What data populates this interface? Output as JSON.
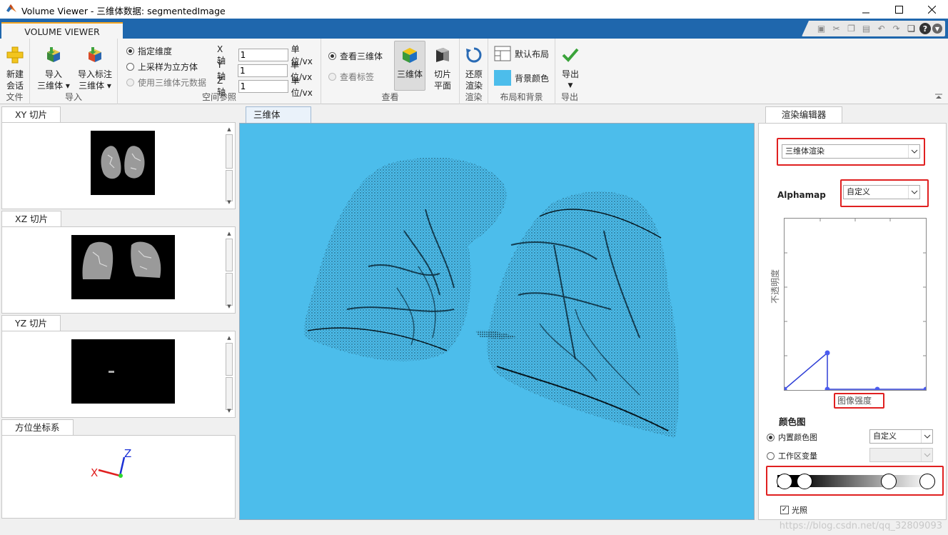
{
  "window": {
    "title": "Volume Viewer - 三维体数据: segmentedImage"
  },
  "ribbon_tab": {
    "label": "VOLUME VIEWER"
  },
  "ribbon": {
    "file": {
      "new_session": [
        "新建",
        "会话"
      ],
      "label": "文件"
    },
    "import": {
      "import_volume": [
        "导入",
        "三维体 ▾"
      ],
      "import_labeled": [
        "导入标注",
        "三维体 ▾"
      ],
      "label": "导入"
    },
    "spatial": {
      "opt_specify": "指定维度",
      "opt_upsample": "上采样为立方体",
      "opt_metadata": "使用三维体元数据",
      "x_label": "X 轴",
      "x_value": "1",
      "y_label": "Y 轴",
      "y_value": "1",
      "z_label": "Z 轴",
      "z_value": "1",
      "unit": "单位/vx",
      "label": "空间参照"
    },
    "view": {
      "opt_volume": "查看三维体",
      "opt_labels": "查看标签",
      "volume_btn": "三维体",
      "slice_btn": [
        "切片",
        "平面"
      ],
      "label": "查看"
    },
    "render": {
      "reset": [
        "还原",
        "渲染"
      ],
      "label": "渲染"
    },
    "layout": {
      "default_layout": "默认布局",
      "bg_color": "背景颜色",
      "bg_color_hex": "#4cbdeb",
      "label": "布局和背景"
    },
    "export": {
      "export_btn": "导出",
      "label": "导出"
    }
  },
  "left_panels": {
    "xy": "XY 切片",
    "xz": "XZ 切片",
    "yz": "YZ 切片",
    "orient": "方位坐标系",
    "axis_x": "X",
    "axis_z": "Z"
  },
  "center": {
    "tab": "三维体",
    "bg_hex": "#4cbdeb"
  },
  "render_editor": {
    "tab": "渲染编辑器",
    "mode": "三维体渲染",
    "alphamap_label": "Alphamap",
    "alphamap_value": "自定义",
    "y_axis_label": "不透明度",
    "x_axis_label": "图像强度",
    "colormap_title": "颜色图",
    "opt_builtin": "内置颜色图",
    "builtin_value": "自定义",
    "opt_workspace": "工作区变量",
    "lighting": "光照"
  },
  "watermark": "https://blog.csdn.net/qq_32809093"
}
